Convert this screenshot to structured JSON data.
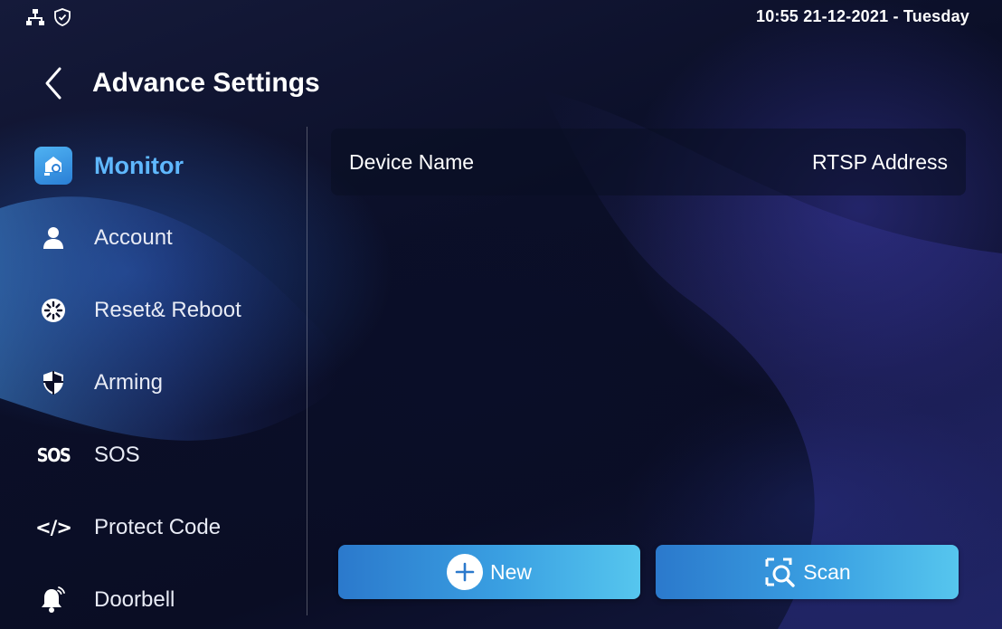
{
  "status_bar": {
    "time_date": "10:55  21-12-2021 - Tuesday",
    "icons": [
      "network-icon",
      "shield-check-icon"
    ]
  },
  "header": {
    "back_icon": "chevron-left-icon",
    "title": "Advance Settings"
  },
  "sidebar": {
    "active_color": "#5fb8ff",
    "items": [
      {
        "label": "Monitor",
        "icon": "monitor-camera-icon",
        "active": true
      },
      {
        "label": "Account",
        "icon": "person-icon",
        "active": false
      },
      {
        "label": "Reset& Reboot",
        "icon": "reset-reboot-icon",
        "active": false
      },
      {
        "label": "Arming",
        "icon": "shield-icon",
        "active": false
      },
      {
        "label": "SOS",
        "icon": "sos-icon",
        "icon_text": "SOS",
        "active": false
      },
      {
        "label": "Protect Code",
        "icon": "code-icon",
        "icon_text": "</>",
        "active": false
      },
      {
        "label": "Doorbell",
        "icon": "bell-icon",
        "active": false
      }
    ]
  },
  "monitor_table": {
    "columns": [
      "Device Name",
      "RTSP Address"
    ],
    "rows": []
  },
  "actions": {
    "new_label": "New",
    "new_icon": "plus-circle-icon",
    "scan_label": "Scan",
    "scan_icon": "scan-search-icon"
  }
}
